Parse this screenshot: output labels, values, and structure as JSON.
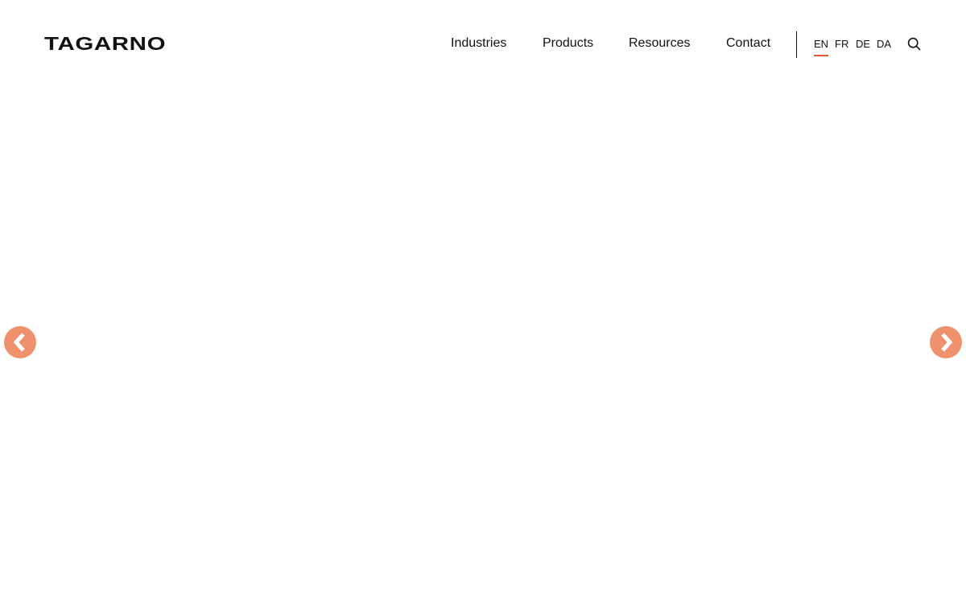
{
  "brand": {
    "logo_text": "TAGARNO"
  },
  "nav": {
    "items": [
      {
        "label": "Industries"
      },
      {
        "label": "Products"
      },
      {
        "label": "Resources"
      },
      {
        "label": "Contact"
      }
    ]
  },
  "languages": {
    "items": [
      {
        "label": "EN",
        "active": true
      },
      {
        "label": "FR",
        "active": false
      },
      {
        "label": "DE",
        "active": false
      },
      {
        "label": "DA",
        "active": false
      }
    ]
  },
  "icons": {
    "search": "search-icon",
    "prev": "chevron-left-icon",
    "next": "chevron-right-icon"
  },
  "colors": {
    "accent": "#e4572e",
    "carousel_arrow": "#f0916e",
    "text": "#111111",
    "background": "#ffffff"
  }
}
